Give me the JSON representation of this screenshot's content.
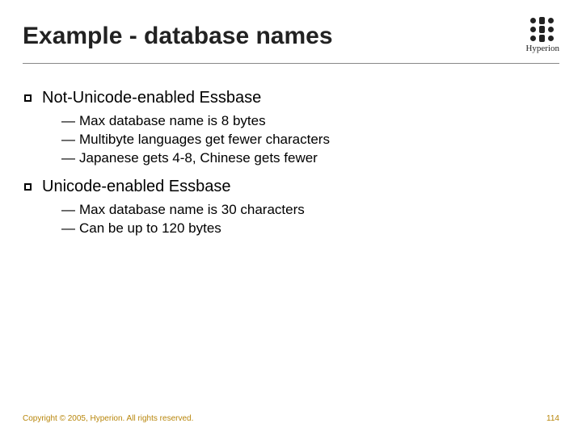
{
  "title": "Example - database names",
  "brand": "Hyperion",
  "sections": [
    {
      "heading": "Not-Unicode-enabled Essbase",
      "items": [
        "Max database name is 8 bytes",
        "Multibyte languages get fewer characters",
        "Japanese gets 4-8, Chinese gets fewer"
      ]
    },
    {
      "heading": "Unicode-enabled Essbase",
      "items": [
        "Max database name is 30 characters",
        "Can be up to 120 bytes"
      ]
    }
  ],
  "footer": {
    "copyright": "Copyright © 2005, Hyperion. All rights reserved.",
    "page": "114"
  }
}
